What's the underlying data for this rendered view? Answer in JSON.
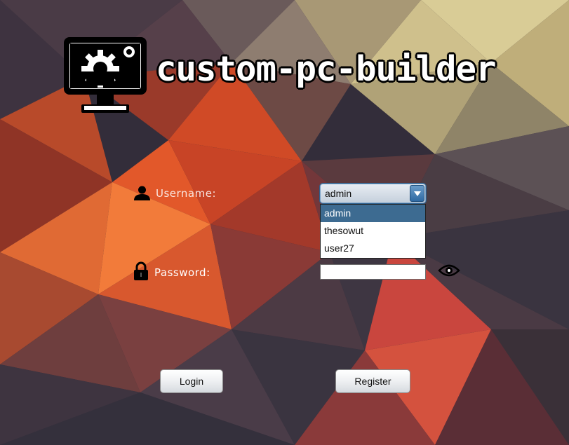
{
  "app": {
    "title": "custom-pc-builder",
    "logo_icon": "monitor-gear-icon"
  },
  "username": {
    "icon": "user-icon",
    "label": "Username:",
    "selected": "admin",
    "options": [
      "admin",
      "thesowut",
      "user27"
    ],
    "highlighted_option": "admin"
  },
  "password": {
    "icon": "lock-icon",
    "label": "Password:",
    "value": "",
    "toggle_icon": "eye-icon"
  },
  "buttons": {
    "login": "Login",
    "register": "Register"
  },
  "colors": {
    "highlight": "#3d6b91",
    "combo_accent": "#2f6aa3"
  }
}
